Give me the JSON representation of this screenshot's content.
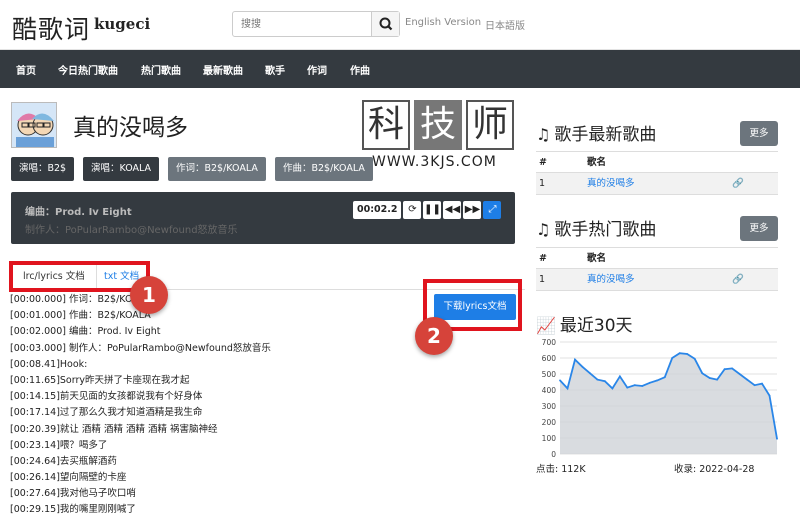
{
  "header": {
    "logo_cn": "酷歌词",
    "logo_latin": "kugeci",
    "search_placeholder": "搜搜",
    "lang_en": "English Version",
    "lang_ja": "日本語版"
  },
  "nav": {
    "items": [
      "首页",
      "今日热门歌曲",
      "热门歌曲",
      "最新歌曲",
      "歌手",
      "作词",
      "作曲"
    ]
  },
  "song": {
    "title": "真的没喝多",
    "tags": [
      "演唱：B2$",
      "演唱：KOALA",
      "作词：B2$/KOALA",
      "作曲：B2$/KOALA"
    ]
  },
  "player": {
    "arranger": "编曲：Prod. Iv Eight",
    "producer": "制作人：PoPularRambo@Newfound怒放音乐",
    "timecode": "00:02.2"
  },
  "watermark": {
    "chars": [
      "科",
      "技",
      "师"
    ],
    "url": "WWW.3KJS.COM"
  },
  "tabs": {
    "lrc": "lrc/lyrics 文档",
    "txt": "txt 文档"
  },
  "download_label": "下载lyrics文档",
  "callouts": [
    "1",
    "2"
  ],
  "lyrics": [
    "[00:00.000] 作词：B2$/KOALA",
    "[00:01.000] 作曲：B2$/KOALA",
    "[00:02.000] 编曲：Prod. Iv Eight",
    "[00:03.000] 制作人：PoPularRambo@Newfound怒放音乐",
    "[00:08.41]Hook:",
    "[00:11.65]Sorry昨天拼了卡座现在我才起",
    "[00:14.15]前天见面的女孩都说我有个好身体",
    "[00:17.14]过了那么久我才知道酒精是我生命",
    "[00:20.39]就让 酒精 酒精 酒精 酒精 祸害脑神经",
    "[00:23.14]喂？喝多了",
    "[00:24.64]去买瓶解酒药",
    "[00:26.14]望向隔壁的卡座",
    "[00:27.64]我对他马子吹口哨",
    "[00:29.15]我的嘴里刚刚喊了"
  ],
  "sidebar": {
    "latest": {
      "title": "歌手最新歌曲",
      "more": "更多",
      "head_num": "#",
      "head_name": "歌名",
      "rows": [
        {
          "num": "1",
          "name": "真的没喝多"
        }
      ]
    },
    "hot": {
      "title": "歌手热门歌曲",
      "more": "更多",
      "head_num": "#",
      "head_name": "歌名",
      "rows": [
        {
          "num": "1",
          "name": "真的没喝多"
        }
      ]
    },
    "stats": {
      "title": "最近30天",
      "plays_label": "点击: 112K",
      "archived_label": "收录: 2022-04-28"
    }
  },
  "colors": {
    "nav_bg": "#343a40",
    "link_blue": "#1e7ee6",
    "callout_red": "#e0141e",
    "badge_red": "#d6433a",
    "chart_line": "#2a86e8",
    "chart_fill": "#cfd3d8"
  },
  "chart_data": {
    "type": "area",
    "title": "最近30天",
    "ylim": [
      0,
      700
    ],
    "yticks": [
      0,
      100,
      200,
      300,
      400,
      500,
      600,
      700
    ],
    "x": [
      1,
      2,
      3,
      4,
      5,
      6,
      7,
      8,
      9,
      10,
      11,
      12,
      13,
      14,
      15,
      16,
      17,
      18,
      19,
      20,
      21,
      22,
      23,
      24,
      25,
      26,
      27,
      28,
      29,
      30
    ],
    "values": [
      460,
      410,
      590,
      545,
      505,
      465,
      455,
      410,
      485,
      415,
      430,
      425,
      445,
      460,
      480,
      600,
      630,
      625,
      595,
      505,
      475,
      465,
      530,
      535,
      500,
      465,
      430,
      440,
      365,
      95
    ],
    "grid": true
  }
}
